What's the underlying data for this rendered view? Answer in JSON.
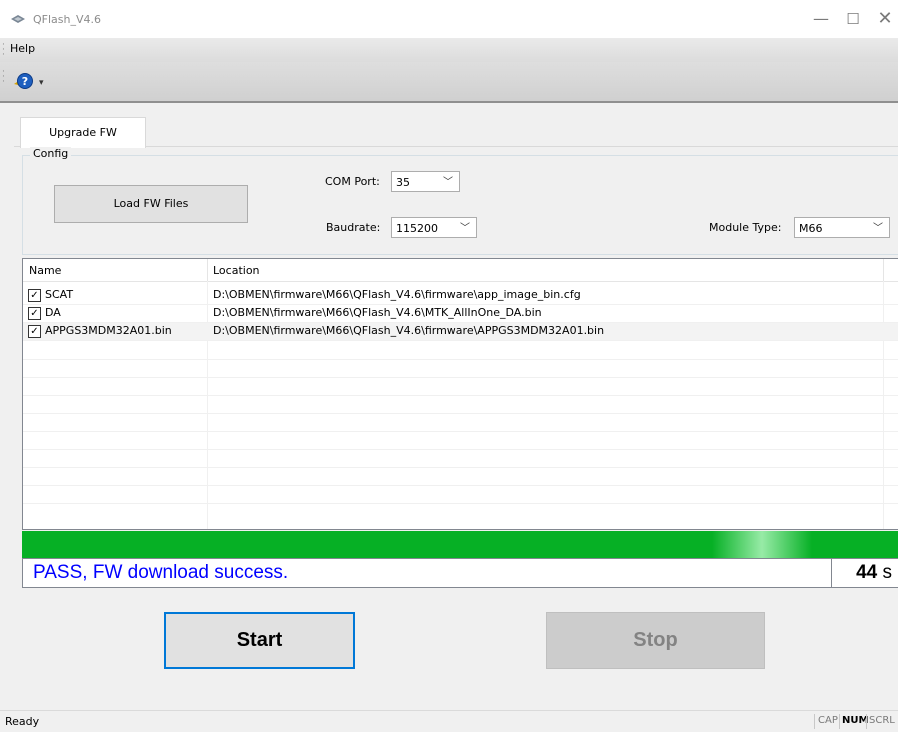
{
  "window": {
    "title": "QFlash_V4.6",
    "minimize": "—",
    "maximize": "☐",
    "close": "✕"
  },
  "menu": {
    "help": "Help"
  },
  "toolbar": {
    "help_icon": "help-question-icon",
    "dropdown_glyph": "▾"
  },
  "tab": {
    "label": "Upgrade FW"
  },
  "config": {
    "legend": "Config",
    "load_button": "Load FW Files",
    "com_port_label": "COM Port:",
    "com_port_value": "35",
    "baudrate_label": "Baudrate:",
    "baudrate_value": "115200",
    "module_type_label": "Module Type:",
    "module_type_value": "M66"
  },
  "files": {
    "columns": [
      "Name",
      "Location"
    ],
    "rows": [
      {
        "checked": true,
        "name": "SCAT",
        "location": "D:\\OBMEN\\firmware\\M66\\QFlash_V4.6\\firmware\\app_image_bin.cfg"
      },
      {
        "checked": true,
        "name": "DA",
        "location": "D:\\OBMEN\\firmware\\M66\\QFlash_V4.6\\MTK_AllInOne_DA.bin"
      },
      {
        "checked": true,
        "name": "APPGS3MDM32A01.bin",
        "location": "D:\\OBMEN\\firmware\\M66\\QFlash_V4.6\\firmware\\APPGS3MDM32A01.bin"
      }
    ]
  },
  "progress": {
    "fraction": 1.0,
    "color": "#06b025"
  },
  "result": {
    "message": "PASS, FW download success.",
    "elapsed_value": "44",
    "elapsed_unit": "s",
    "message_color": "#0000ff"
  },
  "actions": {
    "start_label": "Start",
    "stop_label": "Stop"
  },
  "statusbar": {
    "status": "Ready",
    "cap": "CAP",
    "num": "NUM",
    "scrl": "SCRL"
  },
  "colors": {
    "accent": "#0078d7",
    "progress_green": "#06b025"
  }
}
